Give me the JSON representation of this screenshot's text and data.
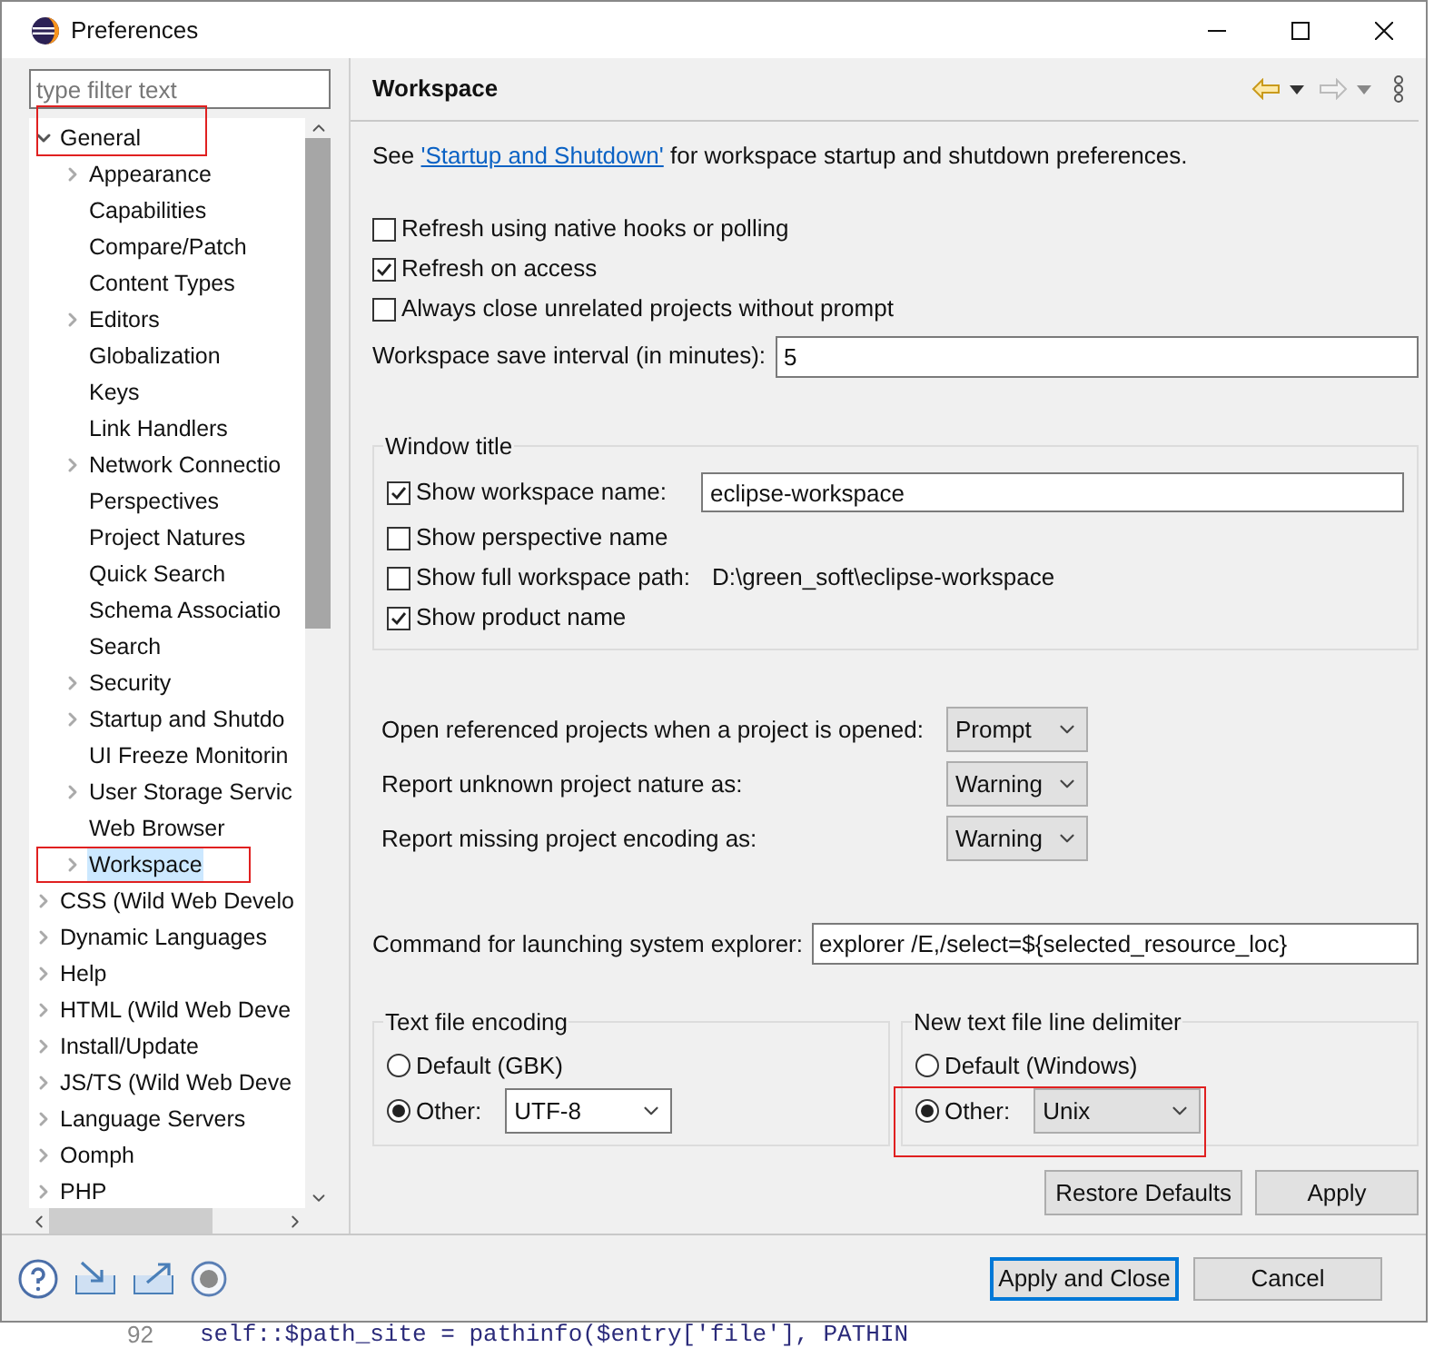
{
  "window": {
    "title": "Preferences"
  },
  "filter": {
    "placeholder": "type filter text"
  },
  "tree": [
    {
      "label": "General",
      "expandable": true,
      "expanded": true,
      "selected": false,
      "children": [
        {
          "label": "Appearance",
          "expandable": true,
          "expanded": false,
          "selected": false
        },
        {
          "label": "Capabilities",
          "expandable": false,
          "selected": false
        },
        {
          "label": "Compare/Patch",
          "expandable": false,
          "selected": false
        },
        {
          "label": "Content Types",
          "expandable": false,
          "selected": false
        },
        {
          "label": "Editors",
          "expandable": true,
          "expanded": false,
          "selected": false
        },
        {
          "label": "Globalization",
          "expandable": false,
          "selected": false
        },
        {
          "label": "Keys",
          "expandable": false,
          "selected": false
        },
        {
          "label": "Link Handlers",
          "expandable": false,
          "selected": false
        },
        {
          "label": "Network Connectio",
          "expandable": true,
          "expanded": false,
          "selected": false
        },
        {
          "label": "Perspectives",
          "expandable": false,
          "selected": false
        },
        {
          "label": "Project Natures",
          "expandable": false,
          "selected": false
        },
        {
          "label": "Quick Search",
          "expandable": false,
          "selected": false
        },
        {
          "label": "Schema Associatio",
          "expandable": false,
          "selected": false
        },
        {
          "label": "Search",
          "expandable": false,
          "selected": false
        },
        {
          "label": "Security",
          "expandable": true,
          "expanded": false,
          "selected": false
        },
        {
          "label": "Startup and Shutdo",
          "expandable": true,
          "expanded": false,
          "selected": false
        },
        {
          "label": "UI Freeze Monitorin",
          "expandable": false,
          "selected": false
        },
        {
          "label": "User Storage Servic",
          "expandable": true,
          "expanded": false,
          "selected": false
        },
        {
          "label": "Web Browser",
          "expandable": false,
          "selected": false
        },
        {
          "label": "Workspace",
          "expandable": true,
          "expanded": false,
          "selected": true
        }
      ]
    },
    {
      "label": "CSS (Wild Web Develo",
      "expandable": true,
      "expanded": false,
      "selected": false
    },
    {
      "label": "Dynamic Languages",
      "expandable": true,
      "expanded": false,
      "selected": false
    },
    {
      "label": "Help",
      "expandable": true,
      "expanded": false,
      "selected": false
    },
    {
      "label": "HTML (Wild Web Deve",
      "expandable": true,
      "expanded": false,
      "selected": false
    },
    {
      "label": "Install/Update",
      "expandable": true,
      "expanded": false,
      "selected": false
    },
    {
      "label": "JS/TS (Wild Web Deve",
      "expandable": true,
      "expanded": false,
      "selected": false
    },
    {
      "label": "Language Servers",
      "expandable": true,
      "expanded": false,
      "selected": false
    },
    {
      "label": "Oomph",
      "expandable": true,
      "expanded": false,
      "selected": false
    },
    {
      "label": "PHP",
      "expandable": true,
      "expanded": false,
      "selected": false
    }
  ],
  "page": {
    "title": "Workspace",
    "intro": {
      "before": "See ",
      "link": "'Startup and Shutdown'",
      "after": " for workspace startup and shutdown preferences."
    },
    "checkboxes": [
      {
        "label": "Refresh using native hooks or polling",
        "checked": false
      },
      {
        "label": "Refresh on access",
        "checked": true
      },
      {
        "label": "Always close unrelated projects without prompt",
        "checked": false
      }
    ],
    "save_interval": {
      "label": "Workspace save interval (in minutes):",
      "value": "5"
    },
    "window_title": {
      "legend": "Window title",
      "rows": [
        {
          "kind": "field",
          "label": "Show workspace name:",
          "checked": true,
          "value": "eclipse-workspace"
        },
        {
          "kind": "plain",
          "label": "Show perspective name",
          "checked": false
        },
        {
          "kind": "text",
          "label": "Show full workspace path:",
          "checked": false,
          "text": "D:\\green_soft\\eclipse-workspace"
        },
        {
          "kind": "plain",
          "label": "Show product name",
          "checked": true
        }
      ]
    },
    "dropdowns": [
      {
        "label": "Open referenced projects when a project is opened:",
        "value": "Prompt"
      },
      {
        "label": "Report unknown project nature as:",
        "value": "Warning"
      },
      {
        "label": "Report missing project encoding as:",
        "value": "Warning"
      }
    ],
    "explorer_command": {
      "label": "Command for launching system explorer:",
      "value": "explorer /E,/select=${selected_resource_loc}"
    },
    "groups": [
      {
        "legend": "Text file encoding",
        "options": [
          {
            "label": "Default (GBK)",
            "selected": false
          },
          {
            "label": "Other:",
            "selected": true,
            "combo": {
              "kind": "editable",
              "value": "UTF-8"
            }
          }
        ]
      },
      {
        "legend": "New text file line delimiter",
        "options": [
          {
            "label": "Default (Windows)",
            "selected": false
          },
          {
            "label": "Other:",
            "selected": true,
            "combo": {
              "kind": "readonly",
              "value": "Unix"
            }
          }
        ]
      }
    ],
    "buttons": [
      "Restore Defaults",
      "Apply"
    ]
  },
  "dialog_buttons": [
    {
      "label": "Apply and Close",
      "default": true
    },
    {
      "label": "Cancel",
      "default": false
    }
  ],
  "background_editor": {
    "line_number": "92",
    "code": "self::$path_site = pathinfo($entry['file'], PATHIN"
  }
}
